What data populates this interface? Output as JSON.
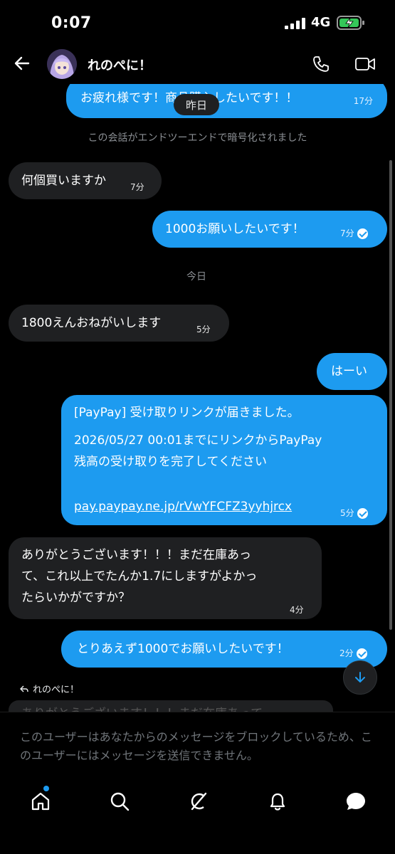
{
  "status_bar": {
    "time": "0:07",
    "network": "4G"
  },
  "header": {
    "contact_name": "れのぺに！"
  },
  "chat": {
    "top_partial": {
      "text": "お疲れ様です！商品購入したいです！！",
      "time": "17分"
    },
    "yesterday_label": "昨日",
    "encryption_notice": "この会話がエンドツーエンドで暗号化されました",
    "today_label": "今日",
    "messages": [
      {
        "text": "何個買いますか",
        "time": "7分"
      },
      {
        "text": "1000お願いしたいです！",
        "time": "7分"
      },
      {
        "text": "1800えんおねがいします",
        "time": "5分"
      },
      {
        "text": "はーい"
      },
      {
        "line1": "[PayPay] 受け取りリンクが届きました。",
        "line2": "2026/05/27 00:01までにリンクからPayPay",
        "line3": "残高の受け取りを完了してください",
        "link": "pay.paypay.ne.jp/rVwYFCFZ3yyhjrcx",
        "time": "5分"
      },
      {
        "line1": "ありがとうございます！！！まだ在庫あっ",
        "line2": "て、これ以上でたんか1.7にしますがよかっ",
        "line3": "たらいかがですか？",
        "time": "4分"
      },
      {
        "text": "とりあえず1000でお願いしたいです！",
        "time": "2分"
      }
    ],
    "reply_to_name": "れのぺに！",
    "reply_preview_text": "ありがとうございます！！！まだ在庫あって"
  },
  "blocked_notice": "このユーザーはあなたからのメッセージをブロックしているため、このユーザーにはメッセージを送信できません。",
  "tabs": {
    "home": "home-icon",
    "search": "search-icon",
    "grok": "grok-icon",
    "notifications": "bell-icon",
    "messages": "messages-icon"
  },
  "colors": {
    "accent": "#1d9bf0",
    "incoming_bubble": "#1f2022",
    "background": "#000000"
  }
}
